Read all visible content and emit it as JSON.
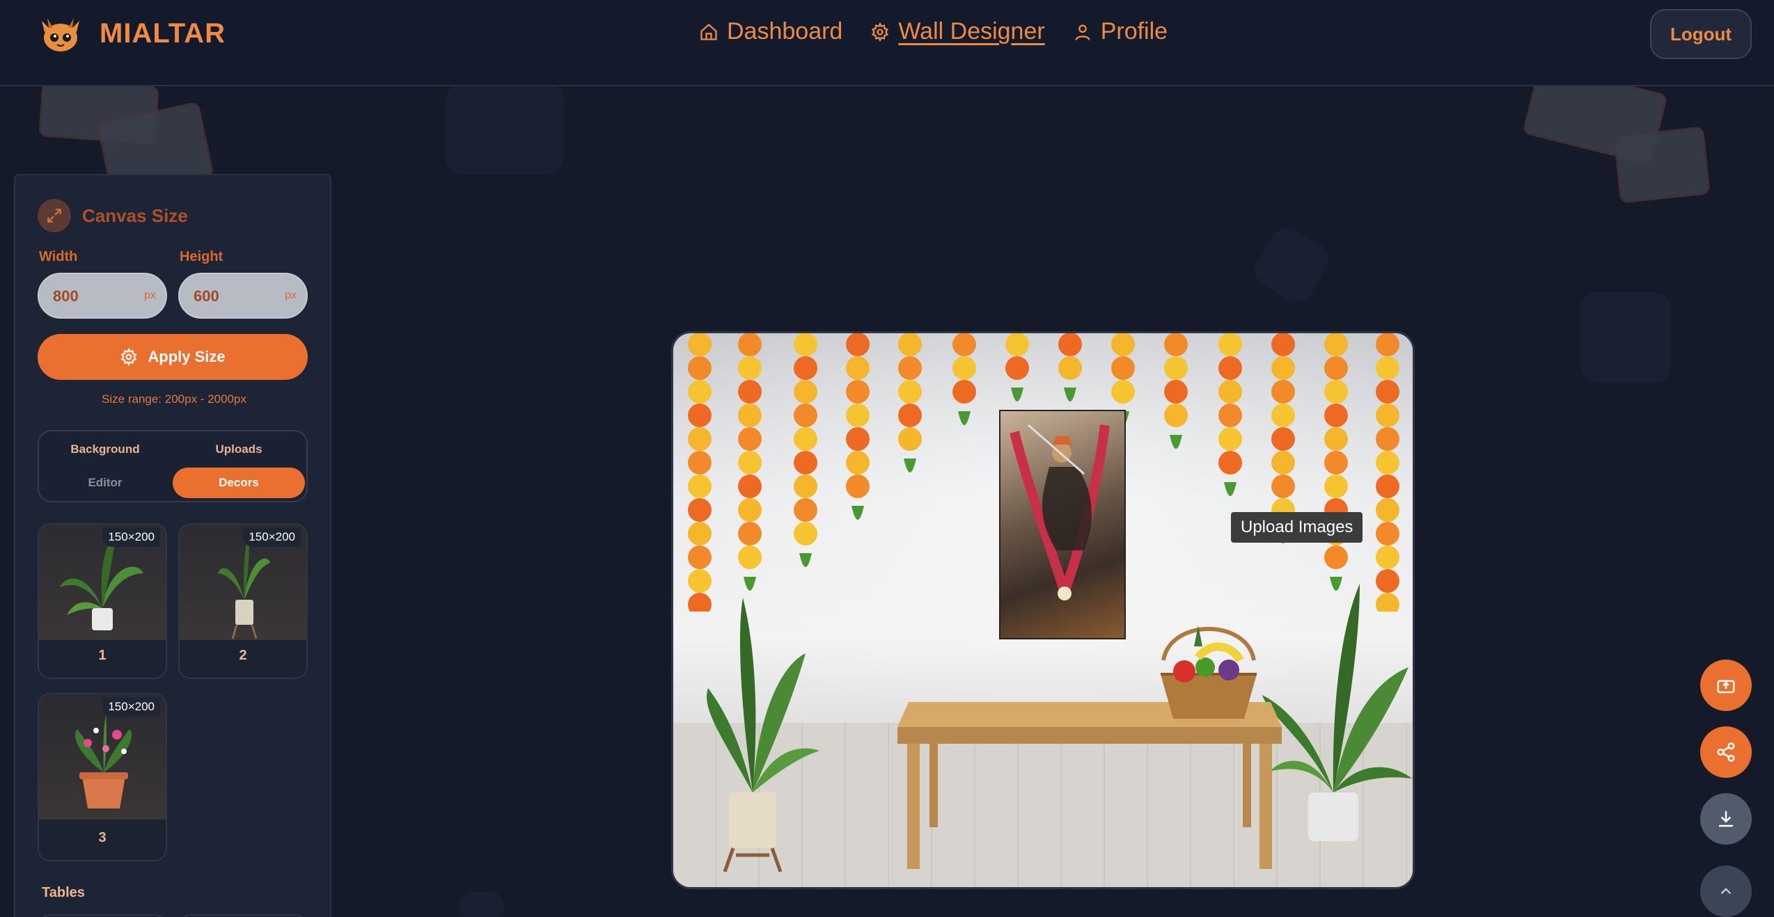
{
  "header": {
    "brand": "MIALTAR",
    "nav": [
      {
        "label": "Dashboard",
        "icon": "home-icon"
      },
      {
        "label": "Wall Designer",
        "icon": "gear-icon",
        "active": true
      },
      {
        "label": "Profile",
        "icon": "user-icon"
      }
    ],
    "logout_label": "Logout"
  },
  "sidebar": {
    "canvas_size_title": "Canvas Size",
    "width_label": "Width",
    "height_label": "Height",
    "width_value": "800",
    "height_value": "600",
    "unit": "px",
    "apply_label": "Apply Size",
    "range_text": "Size range: 200px - 2000px",
    "tabs": [
      {
        "label": "Background"
      },
      {
        "label": "Uploads"
      },
      {
        "label": "Editor"
      },
      {
        "label": "Decors",
        "active": true
      }
    ],
    "decor_items": [
      {
        "number": "1",
        "dims": "150×200"
      },
      {
        "number": "2",
        "dims": "150×200"
      },
      {
        "number": "3",
        "dims": "150×200"
      }
    ],
    "tables_title": "Tables"
  },
  "canvas": {
    "tooltip": "Upload Images"
  },
  "colors": {
    "accent": "#e9702f",
    "background": "#141a2a",
    "panel": "#1d2435"
  },
  "fabs": [
    "upload-icon",
    "share-icon",
    "download-icon",
    "chevron-up-icon"
  ]
}
